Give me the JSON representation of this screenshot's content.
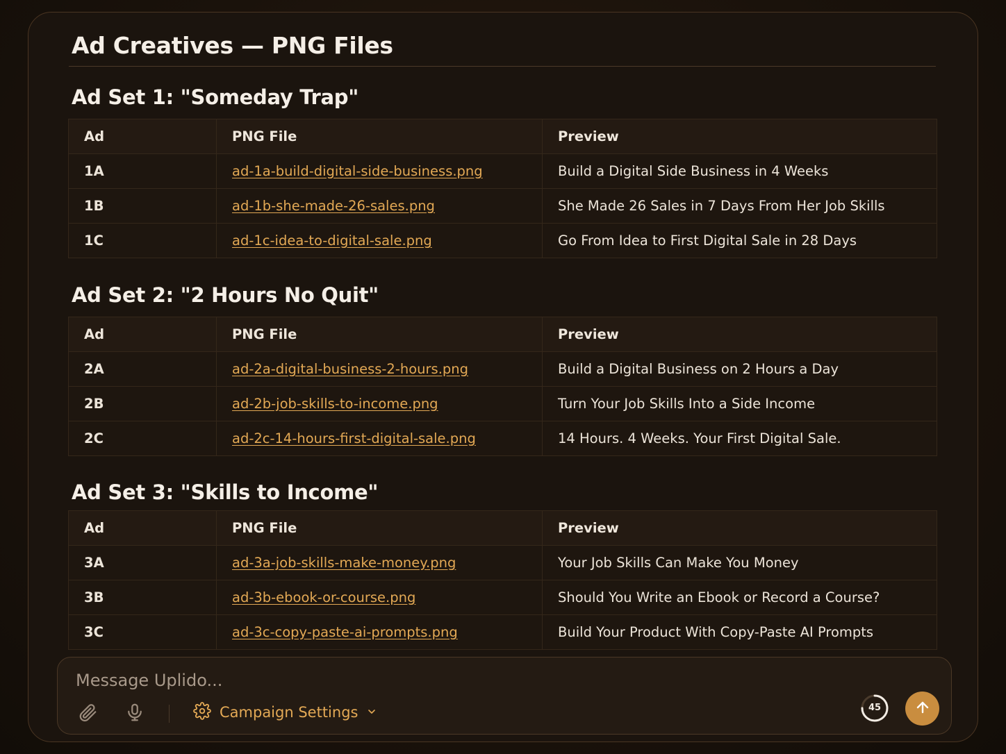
{
  "title": "Ad Creatives — PNG Files",
  "columns": {
    "ad": "Ad",
    "file": "PNG File",
    "preview": "Preview"
  },
  "sets": [
    {
      "heading": "Ad Set 1: \"Someday Trap\"",
      "rows": [
        {
          "ad": "1A",
          "file": "ad-1a-build-digital-side-business.png",
          "preview": "Build a Digital Side Business in 4 Weeks"
        },
        {
          "ad": "1B",
          "file": "ad-1b-she-made-26-sales.png",
          "preview": "She Made 26 Sales in 7 Days From Her Job Skills"
        },
        {
          "ad": "1C",
          "file": "ad-1c-idea-to-digital-sale.png",
          "preview": "Go From Idea to First Digital Sale in 28 Days"
        }
      ]
    },
    {
      "heading": "Ad Set 2: \"2 Hours No Quit\"",
      "rows": [
        {
          "ad": "2A",
          "file": "ad-2a-digital-business-2-hours.png",
          "preview": "Build a Digital Business on 2 Hours a Day"
        },
        {
          "ad": "2B",
          "file": "ad-2b-job-skills-to-income.png",
          "preview": "Turn Your Job Skills Into a Side Income"
        },
        {
          "ad": "2C",
          "file": "ad-2c-14-hours-first-digital-sale.png",
          "preview": "14 Hours. 4 Weeks. Your First Digital Sale."
        }
      ]
    },
    {
      "heading": "Ad Set 3: \"Skills to Income\"",
      "rows": [
        {
          "ad": "3A",
          "file": "ad-3a-job-skills-make-money.png",
          "preview": "Your Job Skills Can Make You Money"
        },
        {
          "ad": "3B",
          "file": "ad-3b-ebook-or-course.png",
          "preview": "Should You Write an Ebook or Record a Course?"
        },
        {
          "ad": "3C",
          "file": "ad-3c-copy-paste-ai-prompts.png",
          "preview": "Build Your Product With Copy-Paste AI Prompts"
        }
      ]
    }
  ],
  "composer": {
    "placeholder": "Message Uplido...",
    "value": "",
    "settings_label": "Campaign Settings",
    "counter": "45",
    "counter_progress": 0.75,
    "icons": [
      "paperclip-icon",
      "microphone-icon",
      "gear-icon",
      "chevron-down-icon",
      "arrow-up-icon"
    ]
  },
  "colors": {
    "accent": "#e3a955",
    "send_button": "#c98d3f",
    "background": "#1b140e"
  }
}
